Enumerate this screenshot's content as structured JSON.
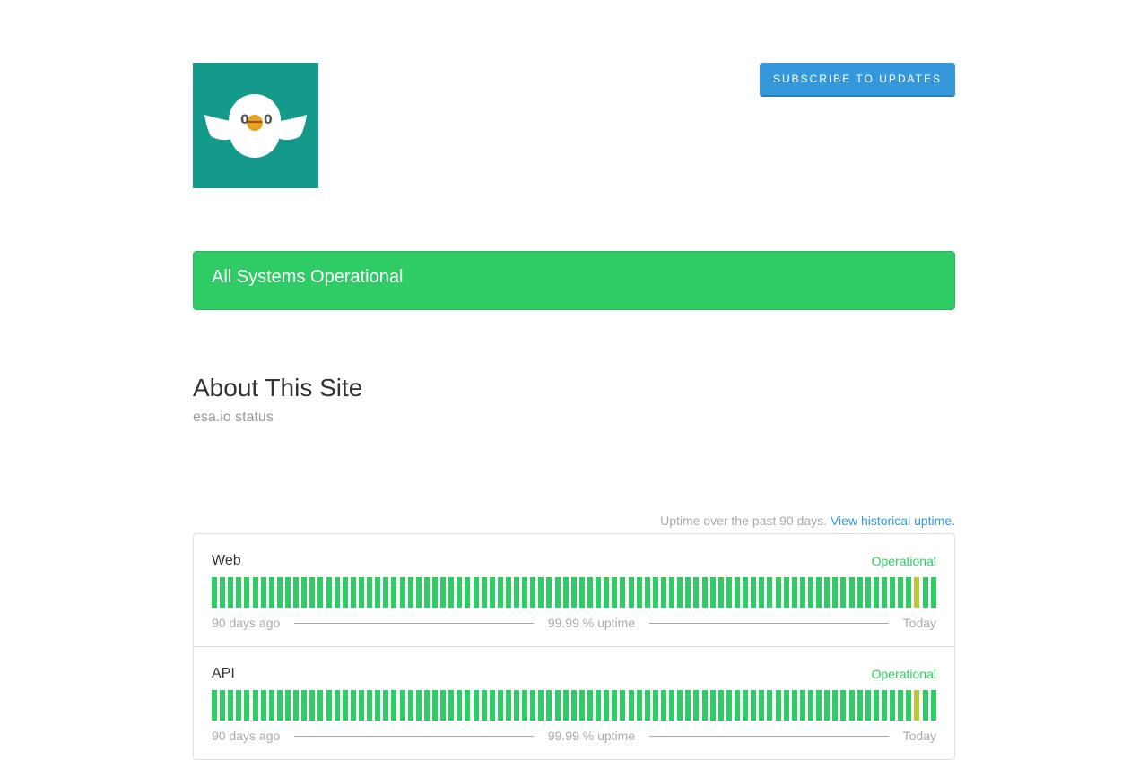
{
  "header": {
    "logo_name": "esa-logo",
    "subscribe_label": "SUBSCRIBE TO UPDATES"
  },
  "status": {
    "text": "All Systems Operational",
    "color": "#2fcc66"
  },
  "about": {
    "title": "About This Site",
    "text": "esa.io status"
  },
  "uptime": {
    "caption": "Uptime over the past 90 days.",
    "link_label": "View historical uptime."
  },
  "colors": {
    "operational": "#2fcc66",
    "minor": "#b8c92f",
    "accent": "#3498db",
    "logo_bg": "#149a8a"
  },
  "components": [
    {
      "name": "Web",
      "status": "Operational",
      "start_label": "90 days ago",
      "uptime_label": "99.99 % uptime",
      "end_label": "Today",
      "days": [
        "ok",
        "ok",
        "ok",
        "ok",
        "ok",
        "ok",
        "ok",
        "ok",
        "ok",
        "ok",
        "ok",
        "ok",
        "ok",
        "ok",
        "ok",
        "ok",
        "ok",
        "ok",
        "ok",
        "ok",
        "ok",
        "ok",
        "ok",
        "ok",
        "ok",
        "ok",
        "ok",
        "ok",
        "ok",
        "ok",
        "ok",
        "ok",
        "ok",
        "ok",
        "ok",
        "ok",
        "ok",
        "ok",
        "ok",
        "ok",
        "ok",
        "ok",
        "ok",
        "ok",
        "ok",
        "ok",
        "ok",
        "ok",
        "ok",
        "ok",
        "ok",
        "ok",
        "ok",
        "ok",
        "ok",
        "ok",
        "ok",
        "ok",
        "ok",
        "ok",
        "ok",
        "ok",
        "ok",
        "ok",
        "ok",
        "ok",
        "ok",
        "ok",
        "ok",
        "ok",
        "ok",
        "ok",
        "ok",
        "ok",
        "ok",
        "ok",
        "ok",
        "ok",
        "ok",
        "ok",
        "ok",
        "ok",
        "ok",
        "ok",
        "ok",
        "ok",
        "minor",
        "ok",
        "ok"
      ]
    },
    {
      "name": "API",
      "status": "Operational",
      "start_label": "90 days ago",
      "uptime_label": "99.99 % uptime",
      "end_label": "Today",
      "days": [
        "ok",
        "ok",
        "ok",
        "ok",
        "ok",
        "ok",
        "ok",
        "ok",
        "ok",
        "ok",
        "ok",
        "ok",
        "ok",
        "ok",
        "ok",
        "ok",
        "ok",
        "ok",
        "ok",
        "ok",
        "ok",
        "ok",
        "ok",
        "ok",
        "ok",
        "ok",
        "ok",
        "ok",
        "ok",
        "ok",
        "ok",
        "ok",
        "ok",
        "ok",
        "ok",
        "ok",
        "ok",
        "ok",
        "ok",
        "ok",
        "ok",
        "ok",
        "ok",
        "ok",
        "ok",
        "ok",
        "ok",
        "ok",
        "ok",
        "ok",
        "ok",
        "ok",
        "ok",
        "ok",
        "ok",
        "ok",
        "ok",
        "ok",
        "ok",
        "ok",
        "ok",
        "ok",
        "ok",
        "ok",
        "ok",
        "ok",
        "ok",
        "ok",
        "ok",
        "ok",
        "ok",
        "ok",
        "ok",
        "ok",
        "ok",
        "ok",
        "ok",
        "ok",
        "ok",
        "ok",
        "ok",
        "ok",
        "ok",
        "ok",
        "ok",
        "ok",
        "minor",
        "ok",
        "ok"
      ]
    }
  ]
}
